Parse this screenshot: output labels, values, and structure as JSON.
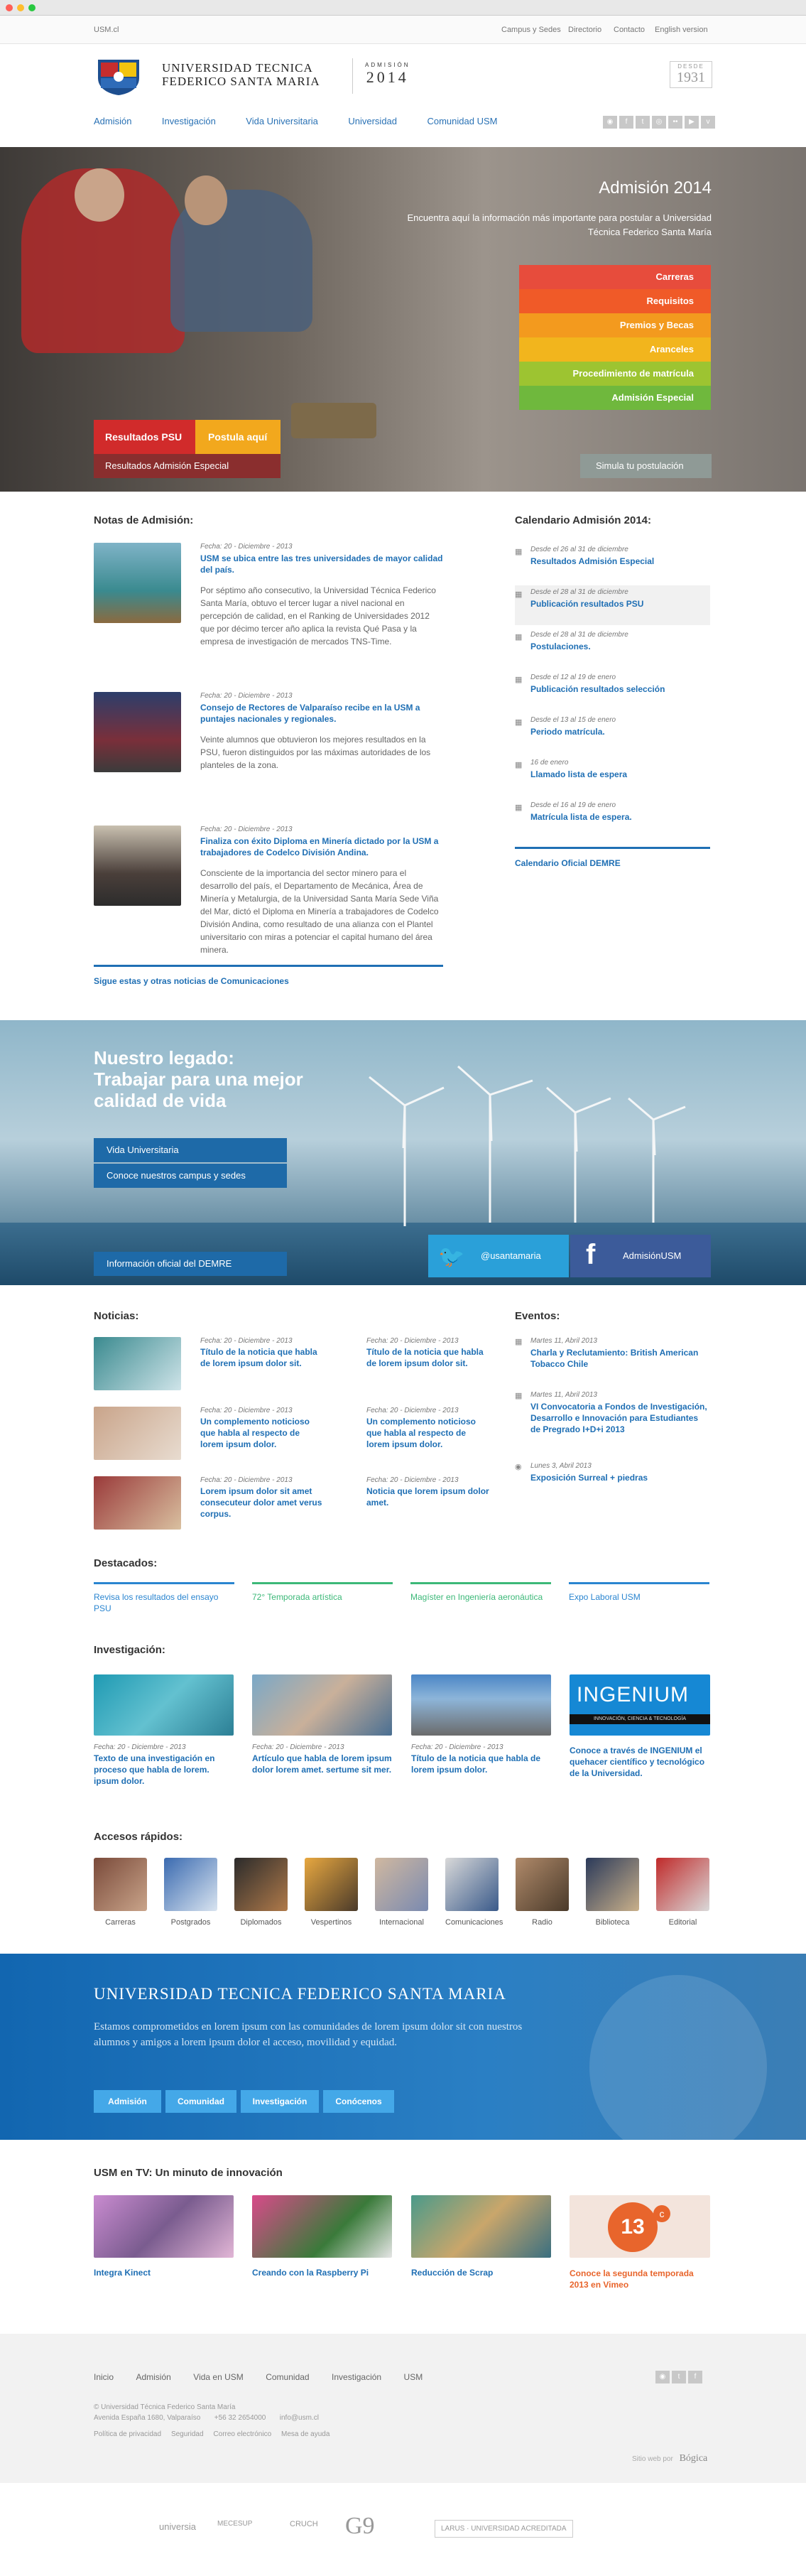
{
  "chrome": {
    "dots": [
      "#ff5f57",
      "#ffbd2e",
      "#28c840"
    ]
  },
  "topbar": {
    "site": "USM.cl",
    "links": [
      "Campus y Sedes",
      "Directorio",
      "Contacto",
      "English version"
    ]
  },
  "header": {
    "name_line1": "UNIVERSIDAD TECNICA",
    "name_line2": "FEDERICO SANTA MARIA",
    "admision_label": "ADMISIÓN",
    "admision_year": "2014",
    "desde_label": "DESDE",
    "desde_year": "1931"
  },
  "nav": {
    "items": [
      "Admisión",
      "Investigación",
      "Vida Universitaria",
      "Universidad",
      "Comunidad USM"
    ]
  },
  "hero": {
    "title": "Admisión 2014",
    "subtitle": "Encuentra aquí la información más importante para postular a Universidad Técnica Federico Santa María",
    "menu": [
      {
        "label": "Carreras",
        "color": "#e74c3c"
      },
      {
        "label": "Requisitos",
        "color": "#f05a28"
      },
      {
        "label": "Premios y Becas",
        "color": "#f39a1e"
      },
      {
        "label": "Aranceles",
        "color": "#f2b51d"
      },
      {
        "label": "Procedimiento de matrícula",
        "color": "#9dc431"
      },
      {
        "label": "Admisión Especial",
        "color": "#6fb83d"
      }
    ],
    "btn_psu": "Resultados PSU",
    "btn_postula": "Postula aquí",
    "btn_resultados": "Resultados Admisión Especial",
    "btn_simula": "Simula tu postulación"
  },
  "notas": {
    "heading": "Notas de Admisión:",
    "items": [
      {
        "date": "Fecha: 20 - Diciembre - 2013",
        "title": "USM se ubica entre las tres universidades de mayor calidad del país.",
        "text": "Por séptimo año consecutivo, la Universidad Técnica Federico Santa María, obtuvo el tercer lugar a nivel nacional en percepción de calidad, en el Ranking de Universidades 2012 que por décimo tercer año aplica la revista Qué Pasa y la empresa de investigación de mercados TNS-Time."
      },
      {
        "date": "Fecha: 20 - Diciembre - 2013",
        "title": "Consejo de Rectores de Valparaíso recibe en la USM a puntajes nacionales y regionales.",
        "text": "Veinte alumnos que obtuvieron los mejores resultados en la PSU, fueron distinguidos por las máximas autoridades de los planteles de la zona."
      },
      {
        "date": "Fecha: 20 - Diciembre - 2013",
        "title": "Finaliza con éxito Diploma en Minería dictado por la USM a trabajadores de Codelco División Andina.",
        "text": "Consciente de la importancia del sector minero para el desarrollo del país, el Departamento de Mecánica, Área de Minería y Metalurgia, de la Universidad Santa María Sede Viña del Mar, dictó el Diploma en Minería a trabajadores de Codelco División Andina, como resultado de una alianza con el Plantel universitario con miras a potenciar el capital humano del área minera."
      }
    ],
    "more": "Sigue estas y otras noticias de Comunicaciones"
  },
  "calendario": {
    "heading": "Calendario Admisión 2014:",
    "items": [
      {
        "date": "Desde el 26 al 31 de diciembre",
        "title": "Resultados Admisión Especial"
      },
      {
        "date": "Desde el 28 al 31 de diciembre",
        "title": "Publicación resultados PSU"
      },
      {
        "date": "Desde el 28 al 31 de diciembre",
        "title": "Postulaciones."
      },
      {
        "date": "Desde el 12 al 19 de enero",
        "title": "Publicación resultados selección"
      },
      {
        "date": "Desde el 13 al 15 de enero",
        "title": "Periodo matrícula."
      },
      {
        "date": "16 de enero",
        "title": "Llamado lista de espera"
      },
      {
        "date": "Desde el 16 al 19 de enero",
        "title": "Matrícula lista de espera."
      }
    ],
    "more": "Calendario Oficial DEMRE"
  },
  "legado": {
    "title_line1": "Nuestro legado:",
    "title_line2": "Trabajar para una mejor",
    "title_line3": "calidad de vida",
    "btns": [
      "Vida Universitaria",
      "Conoce nuestros campus y sedes"
    ],
    "demre": "Información oficial del DEMRE",
    "twitter": "@usantamaria",
    "facebook": "AdmisiónUSM"
  },
  "noticias": {
    "heading": "Noticias:",
    "items": [
      {
        "date": "Fecha: 20 - Diciembre - 2013",
        "title": "Título de la noticia que habla de lorem ipsum dolor sit."
      },
      {
        "date": "Fecha: 20 - Diciembre - 2013",
        "title": "Título de la noticia que habla de lorem ipsum dolor sit."
      },
      {
        "date": "Fecha: 20 - Diciembre - 2013",
        "title": "Un complemento noticioso que habla al respecto de lorem ipsum dolor."
      },
      {
        "date": "Fecha: 20 - Diciembre - 2013",
        "title": "Un complemento noticioso que habla al respecto de lorem ipsum dolor."
      },
      {
        "date": "Fecha: 20 - Diciembre - 2013",
        "title": "Lorem ipsum dolor sit amet consecuteur dolor amet verus corpus."
      },
      {
        "date": "Fecha: 20 - Diciembre - 2013",
        "title": "Noticia que lorem ipsum dolor amet."
      }
    ]
  },
  "eventos": {
    "heading": "Eventos:",
    "items": [
      {
        "date": "Martes 11, Abril 2013",
        "title": "Charla y Reclutamiento: British American Tobacco Chile"
      },
      {
        "date": "Martes 11, Abril 2013",
        "title": "VI Convocatoria a Fondos de Investigación, Desarrollo e Innovación para Estudiantes de Pregrado I+D+i 2013"
      },
      {
        "date": "Lunes 3, Abril 2013",
        "title": "Exposición Surreal + piedras"
      }
    ]
  },
  "destacados": {
    "heading": "Destacados:",
    "items": [
      {
        "label": "Revisa los resultados del ensayo PSU",
        "color": "#2a85d0"
      },
      {
        "label": "72° Temporada artística",
        "color": "#3cb878"
      },
      {
        "label": "Magíster en Ingeniería aeronáutica",
        "color": "#3cb878"
      },
      {
        "label": "Expo Laboral USM",
        "color": "#2a85d0"
      }
    ]
  },
  "investigacion": {
    "heading": "Investigación:",
    "items": [
      {
        "date": "Fecha: 20 - Diciembre - 2013",
        "title": "Texto de una investigación en proceso que habla de lorem. ipsum dolor."
      },
      {
        "date": "Fecha: 20 - Diciembre - 2013",
        "title": "Artículo que habla de lorem ipsum dolor lorem amet. sertume sit mer."
      },
      {
        "date": "Fecha: 20 - Diciembre - 2013",
        "title": "Título de la noticia que habla de lorem ipsum dolor."
      },
      {
        "date": "",
        "title": "Conoce a través de INGENIUM el quehacer científico y tecnológico de la Universidad."
      }
    ],
    "ingenium": "INGENIUM",
    "ingenium_sub": "INNOVACIÓN, CIENCIA & TECNOLOGÍA"
  },
  "accesos": {
    "heading": "Accesos rápidos:",
    "items": [
      "Carreras",
      "Postgrados",
      "Diplomados",
      "Vespertinos",
      "Internacional",
      "Comunicaciones",
      "Radio",
      "Biblioteca",
      "Editorial"
    ]
  },
  "banner": {
    "title": "UNIVERSIDAD TECNICA FEDERICO SANTA MARIA",
    "text": "Estamos comprometidos en lorem ipsum con las comunidades de lorem ipsum dolor sit con nuestros alumnos y amigos a lorem ipsum dolor el acceso, movilidad y equidad.",
    "btns": [
      "Admisión",
      "Comunidad",
      "Investigación",
      "Conócenos"
    ]
  },
  "tv": {
    "heading": "USM en TV: Un minuto de innovación",
    "items": [
      {
        "title": "Integra Kinect"
      },
      {
        "title": "Creando con la Raspberry Pi"
      },
      {
        "title": "Reducción de Scrap"
      },
      {
        "title": "Conoce la segunda temporada 2013 en Vimeo"
      }
    ],
    "badge": "13",
    "badge_c": "c"
  },
  "footer": {
    "links": [
      "Inicio",
      "Admisión",
      "Vida en USM",
      "Comunidad",
      "Investigación",
      "USM"
    ],
    "addr1": "© Universidad Técnica Federico Santa María",
    "addr2": "Avenida España 1680, Valparaíso       +56 32 2654000       info@usm.cl",
    "legal": "Política de privacidad     Seguridad     Correo electrónico     Mesa de ayuda",
    "credit": "Sitio web por",
    "credit_brand": "Bógica",
    "logos": [
      "universia",
      "MECESUP",
      "CRUCH",
      "G9",
      "LARUS · UNIVERSIDAD ACREDITADA"
    ]
  }
}
